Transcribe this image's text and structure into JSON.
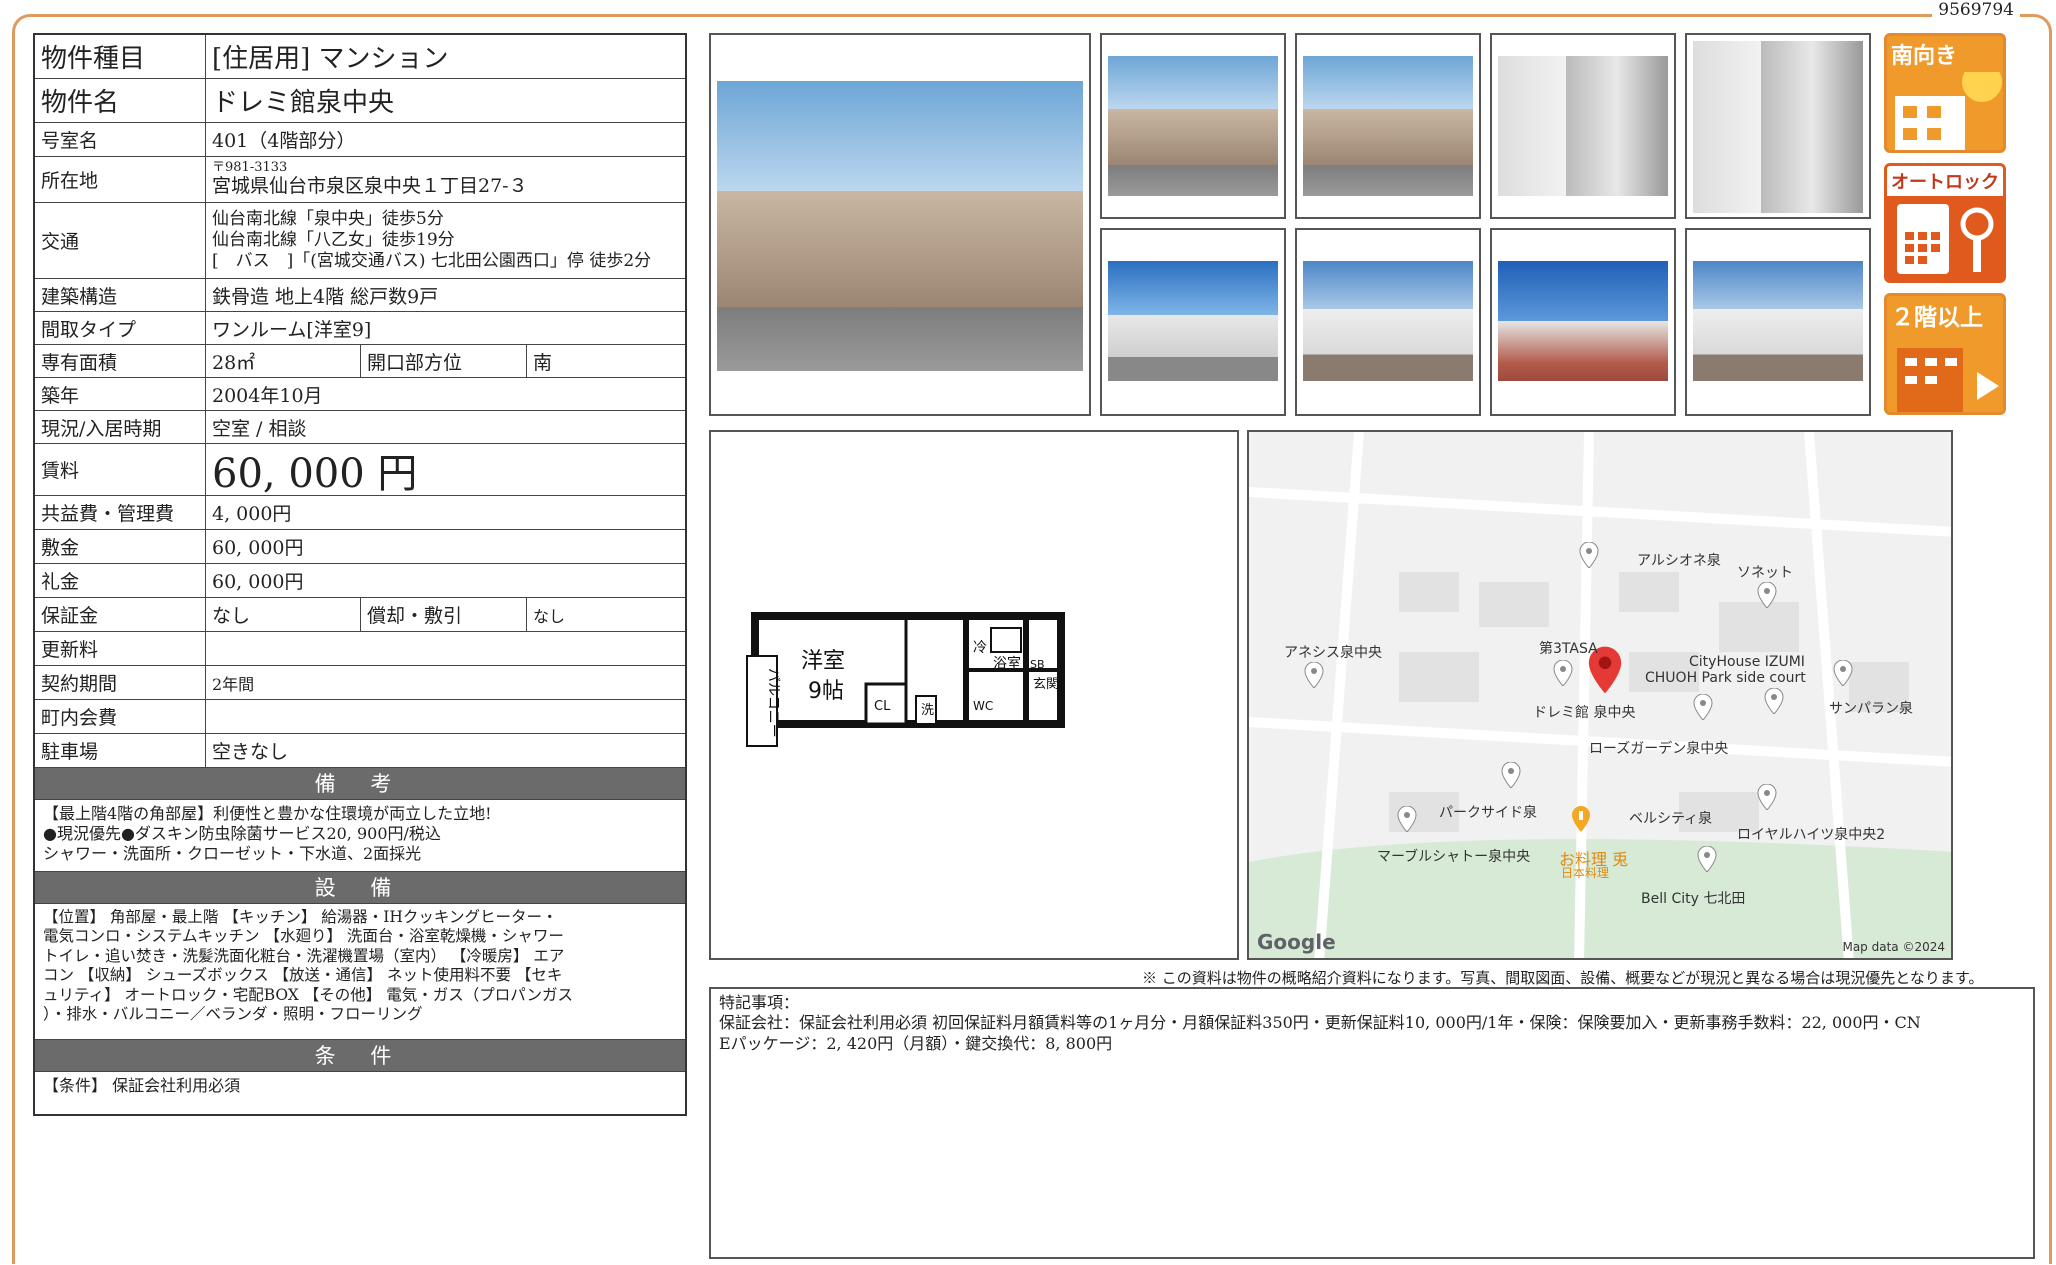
{
  "document_id": "9569794",
  "specs": {
    "type_label": "物件種目",
    "type_value": "[住居用]  マンション",
    "name_label": "物件名",
    "name_value": "ドレミ館泉中央",
    "room_label": "号室名",
    "room_value": "401（4階部分）",
    "address_label": "所在地",
    "address_zip": "〒981-3133",
    "address_value": "宮城県仙台市泉区泉中央１丁目27-３",
    "transit_label": "交通",
    "transit_lines": [
      "仙台南北線「泉中央」徒歩5分",
      "仙台南北線「八乙女」徒歩19分",
      "[　バス　]「(宮城交通バス) 七北田公園西口」停  徒歩2分"
    ],
    "structure_label": "建築構造",
    "structure_value": "鉄骨造  地上4階  総戸数9戸",
    "layout_label": "間取タイプ",
    "layout_value": "ワンルーム[洋室9]",
    "area_label": "専有面積",
    "area_value": "28㎡",
    "orientation_label": "開口部方位",
    "orientation_value": "南",
    "built_label": "築年",
    "built_value": "2004年10月",
    "status_label": "現況/入居時期",
    "status_value": "空室  /  相談",
    "rent_label": "賃料",
    "rent_value": "60, 000  円",
    "fee_label": "共益費・管理費",
    "fee_value": "4, 000円",
    "deposit_label": "敷金",
    "deposit_value": "60, 000円",
    "key_money_label": "礼金",
    "key_money_value": "60, 000円",
    "guarantee_label": "保証金",
    "guarantee_value": "なし",
    "amortization_label": "償却・敷引",
    "amortization_value": "なし",
    "renewal_label": "更新料",
    "renewal_value": "",
    "contract_label": "契約期間",
    "contract_value": "2年間",
    "community_label": "町内会費",
    "community_value": "",
    "parking_label": "駐車場",
    "parking_value": "空きなし"
  },
  "remarks": {
    "title": "備 考",
    "text": "【最上階4階の角部屋】利便性と豊かな住環境が両立した立地!\n●現況優先●ダスキン防虫除菌サービス20, 900円/税込\nシャワー・洗面所・クローゼット・下水道、2面採光"
  },
  "facilities": {
    "title": "設 備",
    "text": "【位置】 角部屋・最上階 【キッチン】 給湯器・IHクッキングヒーター・\n電気コンロ・システムキッチン 【水廻り】 洗面台・浴室乾燥機・シャワー\nトイレ・追い焚き・洗髪洗面化粧台・洗濯機置場（室内） 【冷暖房】 エア\nコン 【収納】 シューズボックス 【放送・通信】 ネット使用料不要 【セキ\nュリティ】 オートロック・宅配BOX 【その他】 電気・ガス（プロパンガス\n）・排水・バルコニー／ベランダ・照明・フローリング"
  },
  "conditions": {
    "title": "条 件",
    "text": "【条件】 保証会社利用必須"
  },
  "badges": {
    "south": "南向き",
    "autolock": "オートロック",
    "upper_floor": "２階以上"
  },
  "floorplan": {
    "room": "洋室",
    "size": "9帖",
    "balcony": "バルコニー",
    "bath": "浴室",
    "fridge": "冷",
    "entrance": "玄関",
    "shoe": "SB",
    "closet": "CL",
    "washer": "洗",
    "wc": "WC"
  },
  "map": {
    "labels": {
      "alsione": "アルシオネ泉",
      "sonett": "ソネット",
      "anesis": "アネシス泉中央",
      "tasa": "第3TASA",
      "cityhouse1": "CityHouse IZUMI",
      "cityhouse2": "CHUOH Park side court",
      "doremi": "ドレミ館 泉中央",
      "sunparan": "サンパラン泉",
      "rosegarden": "ローズガーデン泉中央",
      "parkside": "パークサイド泉",
      "bellcity": "ベルシティ泉",
      "royal": "ロイヤルハイツ泉中央2",
      "marble": "マーブルシャトー泉中央",
      "ryouri1": "お料理 兎",
      "ryouri2": "日本料理",
      "bellcity7": "Bell City 七北田",
      "google": "Google",
      "mapdata": "Map data ©2024"
    }
  },
  "footnote": "※ この資料は物件の概略紹介資料になります。写真、間取図面、設備、概要などが現況と異なる場合は現況優先となります。",
  "special_notes": {
    "title": "特記事項：",
    "line1": "保証会社：保証会社利用必須  初回保証料月額賃料等の1ヶ月分・月額保証料350円・更新保証料10, 000円/1年・保険：保険要加入・更新事務手数料：22, 000円・CN",
    "line2": "Eパッケージ：2, 420円（月額）・鍵交換代：8, 800円"
  }
}
